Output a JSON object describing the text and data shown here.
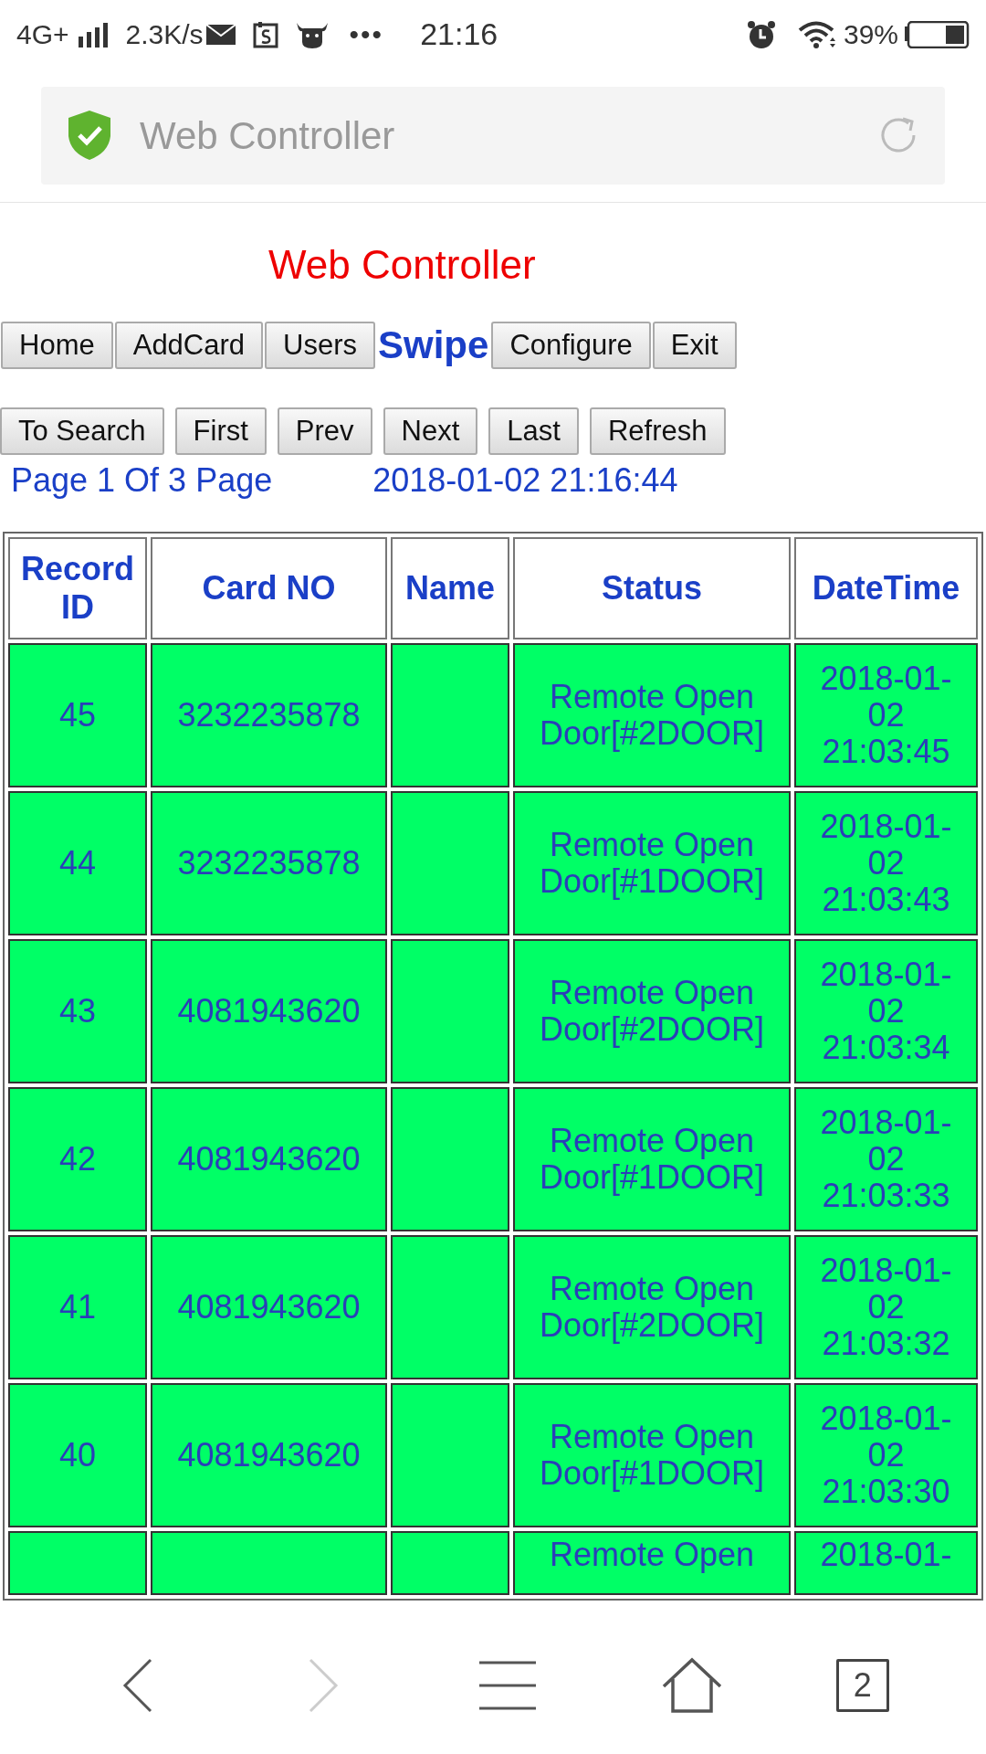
{
  "status_bar": {
    "network": "4G+",
    "speed": "2.3K/s",
    "more": "•••",
    "time": "21:16",
    "battery": "39%"
  },
  "address_bar": {
    "title": "Web Controller"
  },
  "page_title": "Web Controller",
  "nav_tabs": [
    {
      "label": "Home",
      "selected": false
    },
    {
      "label": "AddCard",
      "selected": false
    },
    {
      "label": "Users",
      "selected": false
    },
    {
      "label": "Swipe",
      "selected": true
    },
    {
      "label": "Configure",
      "selected": false
    },
    {
      "label": "Exit",
      "selected": false
    }
  ],
  "pager_buttons": [
    "To Search",
    "First",
    "Prev",
    "Next",
    "Last",
    "Refresh"
  ],
  "page_info": "Page 1 Of 3 Page",
  "server_time": "2018-01-02 21:16:44",
  "table": {
    "columns": [
      "Record ID",
      "Card NO",
      "Name",
      "Status",
      "DateTime"
    ],
    "rows": [
      {
        "record_id": "45",
        "card_no": "3232235878",
        "status": "Remote Open Door[#2DOOR]",
        "datetime": "2018-01-02 21:03:45",
        "cut_off": false
      },
      {
        "record_id": "44",
        "card_no": "3232235878",
        "status": "Remote Open Door[#1DOOR]",
        "datetime": "2018-01-02 21:03:43",
        "cut_off": false
      },
      {
        "record_id": "43",
        "card_no": "4081943620",
        "status": "Remote Open Door[#2DOOR]",
        "datetime": "2018-01-02 21:03:34",
        "cut_off": false
      },
      {
        "record_id": "42",
        "card_no": "4081943620",
        "status": "Remote Open Door[#1DOOR]",
        "datetime": "2018-01-02 21:03:33",
        "cut_off": false
      },
      {
        "record_id": "41",
        "card_no": "4081943620",
        "status": "Remote Open Door[#2DOOR]",
        "datetime": "2018-01-02 21:03:32",
        "cut_off": false
      },
      {
        "record_id": "40",
        "card_no": "4081943620",
        "status": "Remote Open Door[#1DOOR]",
        "datetime": "2018-01-02 21:03:30",
        "cut_off": false
      },
      {
        "status": "Remote Open",
        "datetime": "2018-01-",
        "cut_off": true
      }
    ]
  },
  "bottom_bar": {
    "back": {
      "disabled": false
    },
    "forward": {
      "disabled": true
    },
    "tab_count": "2"
  }
}
